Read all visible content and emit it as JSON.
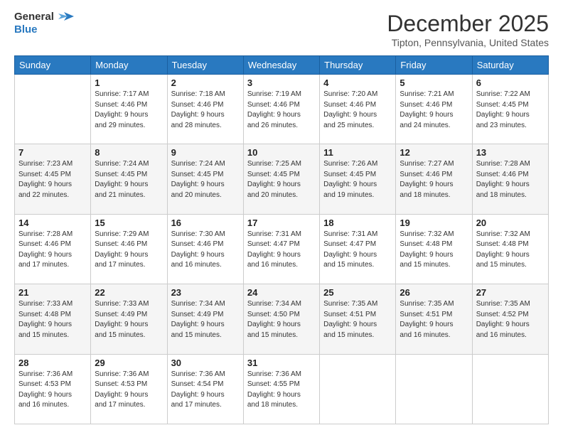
{
  "header": {
    "logo_line1": "General",
    "logo_line2": "Blue",
    "month_title": "December 2025",
    "location": "Tipton, Pennsylvania, United States"
  },
  "days_of_week": [
    "Sunday",
    "Monday",
    "Tuesday",
    "Wednesday",
    "Thursday",
    "Friday",
    "Saturday"
  ],
  "weeks": [
    [
      {
        "day": "",
        "info": ""
      },
      {
        "day": "1",
        "info": "Sunrise: 7:17 AM\nSunset: 4:46 PM\nDaylight: 9 hours\nand 29 minutes."
      },
      {
        "day": "2",
        "info": "Sunrise: 7:18 AM\nSunset: 4:46 PM\nDaylight: 9 hours\nand 28 minutes."
      },
      {
        "day": "3",
        "info": "Sunrise: 7:19 AM\nSunset: 4:46 PM\nDaylight: 9 hours\nand 26 minutes."
      },
      {
        "day": "4",
        "info": "Sunrise: 7:20 AM\nSunset: 4:46 PM\nDaylight: 9 hours\nand 25 minutes."
      },
      {
        "day": "5",
        "info": "Sunrise: 7:21 AM\nSunset: 4:46 PM\nDaylight: 9 hours\nand 24 minutes."
      },
      {
        "day": "6",
        "info": "Sunrise: 7:22 AM\nSunset: 4:45 PM\nDaylight: 9 hours\nand 23 minutes."
      }
    ],
    [
      {
        "day": "7",
        "info": "Sunrise: 7:23 AM\nSunset: 4:45 PM\nDaylight: 9 hours\nand 22 minutes."
      },
      {
        "day": "8",
        "info": "Sunrise: 7:24 AM\nSunset: 4:45 PM\nDaylight: 9 hours\nand 21 minutes."
      },
      {
        "day": "9",
        "info": "Sunrise: 7:24 AM\nSunset: 4:45 PM\nDaylight: 9 hours\nand 20 minutes."
      },
      {
        "day": "10",
        "info": "Sunrise: 7:25 AM\nSunset: 4:45 PM\nDaylight: 9 hours\nand 20 minutes."
      },
      {
        "day": "11",
        "info": "Sunrise: 7:26 AM\nSunset: 4:45 PM\nDaylight: 9 hours\nand 19 minutes."
      },
      {
        "day": "12",
        "info": "Sunrise: 7:27 AM\nSunset: 4:46 PM\nDaylight: 9 hours\nand 18 minutes."
      },
      {
        "day": "13",
        "info": "Sunrise: 7:28 AM\nSunset: 4:46 PM\nDaylight: 9 hours\nand 18 minutes."
      }
    ],
    [
      {
        "day": "14",
        "info": "Sunrise: 7:28 AM\nSunset: 4:46 PM\nDaylight: 9 hours\nand 17 minutes."
      },
      {
        "day": "15",
        "info": "Sunrise: 7:29 AM\nSunset: 4:46 PM\nDaylight: 9 hours\nand 17 minutes."
      },
      {
        "day": "16",
        "info": "Sunrise: 7:30 AM\nSunset: 4:46 PM\nDaylight: 9 hours\nand 16 minutes."
      },
      {
        "day": "17",
        "info": "Sunrise: 7:31 AM\nSunset: 4:47 PM\nDaylight: 9 hours\nand 16 minutes."
      },
      {
        "day": "18",
        "info": "Sunrise: 7:31 AM\nSunset: 4:47 PM\nDaylight: 9 hours\nand 15 minutes."
      },
      {
        "day": "19",
        "info": "Sunrise: 7:32 AM\nSunset: 4:48 PM\nDaylight: 9 hours\nand 15 minutes."
      },
      {
        "day": "20",
        "info": "Sunrise: 7:32 AM\nSunset: 4:48 PM\nDaylight: 9 hours\nand 15 minutes."
      }
    ],
    [
      {
        "day": "21",
        "info": "Sunrise: 7:33 AM\nSunset: 4:48 PM\nDaylight: 9 hours\nand 15 minutes."
      },
      {
        "day": "22",
        "info": "Sunrise: 7:33 AM\nSunset: 4:49 PM\nDaylight: 9 hours\nand 15 minutes."
      },
      {
        "day": "23",
        "info": "Sunrise: 7:34 AM\nSunset: 4:49 PM\nDaylight: 9 hours\nand 15 minutes."
      },
      {
        "day": "24",
        "info": "Sunrise: 7:34 AM\nSunset: 4:50 PM\nDaylight: 9 hours\nand 15 minutes."
      },
      {
        "day": "25",
        "info": "Sunrise: 7:35 AM\nSunset: 4:51 PM\nDaylight: 9 hours\nand 15 minutes."
      },
      {
        "day": "26",
        "info": "Sunrise: 7:35 AM\nSunset: 4:51 PM\nDaylight: 9 hours\nand 16 minutes."
      },
      {
        "day": "27",
        "info": "Sunrise: 7:35 AM\nSunset: 4:52 PM\nDaylight: 9 hours\nand 16 minutes."
      }
    ],
    [
      {
        "day": "28",
        "info": "Sunrise: 7:36 AM\nSunset: 4:53 PM\nDaylight: 9 hours\nand 16 minutes."
      },
      {
        "day": "29",
        "info": "Sunrise: 7:36 AM\nSunset: 4:53 PM\nDaylight: 9 hours\nand 17 minutes."
      },
      {
        "day": "30",
        "info": "Sunrise: 7:36 AM\nSunset: 4:54 PM\nDaylight: 9 hours\nand 17 minutes."
      },
      {
        "day": "31",
        "info": "Sunrise: 7:36 AM\nSunset: 4:55 PM\nDaylight: 9 hours\nand 18 minutes."
      },
      {
        "day": "",
        "info": ""
      },
      {
        "day": "",
        "info": ""
      },
      {
        "day": "",
        "info": ""
      }
    ]
  ]
}
